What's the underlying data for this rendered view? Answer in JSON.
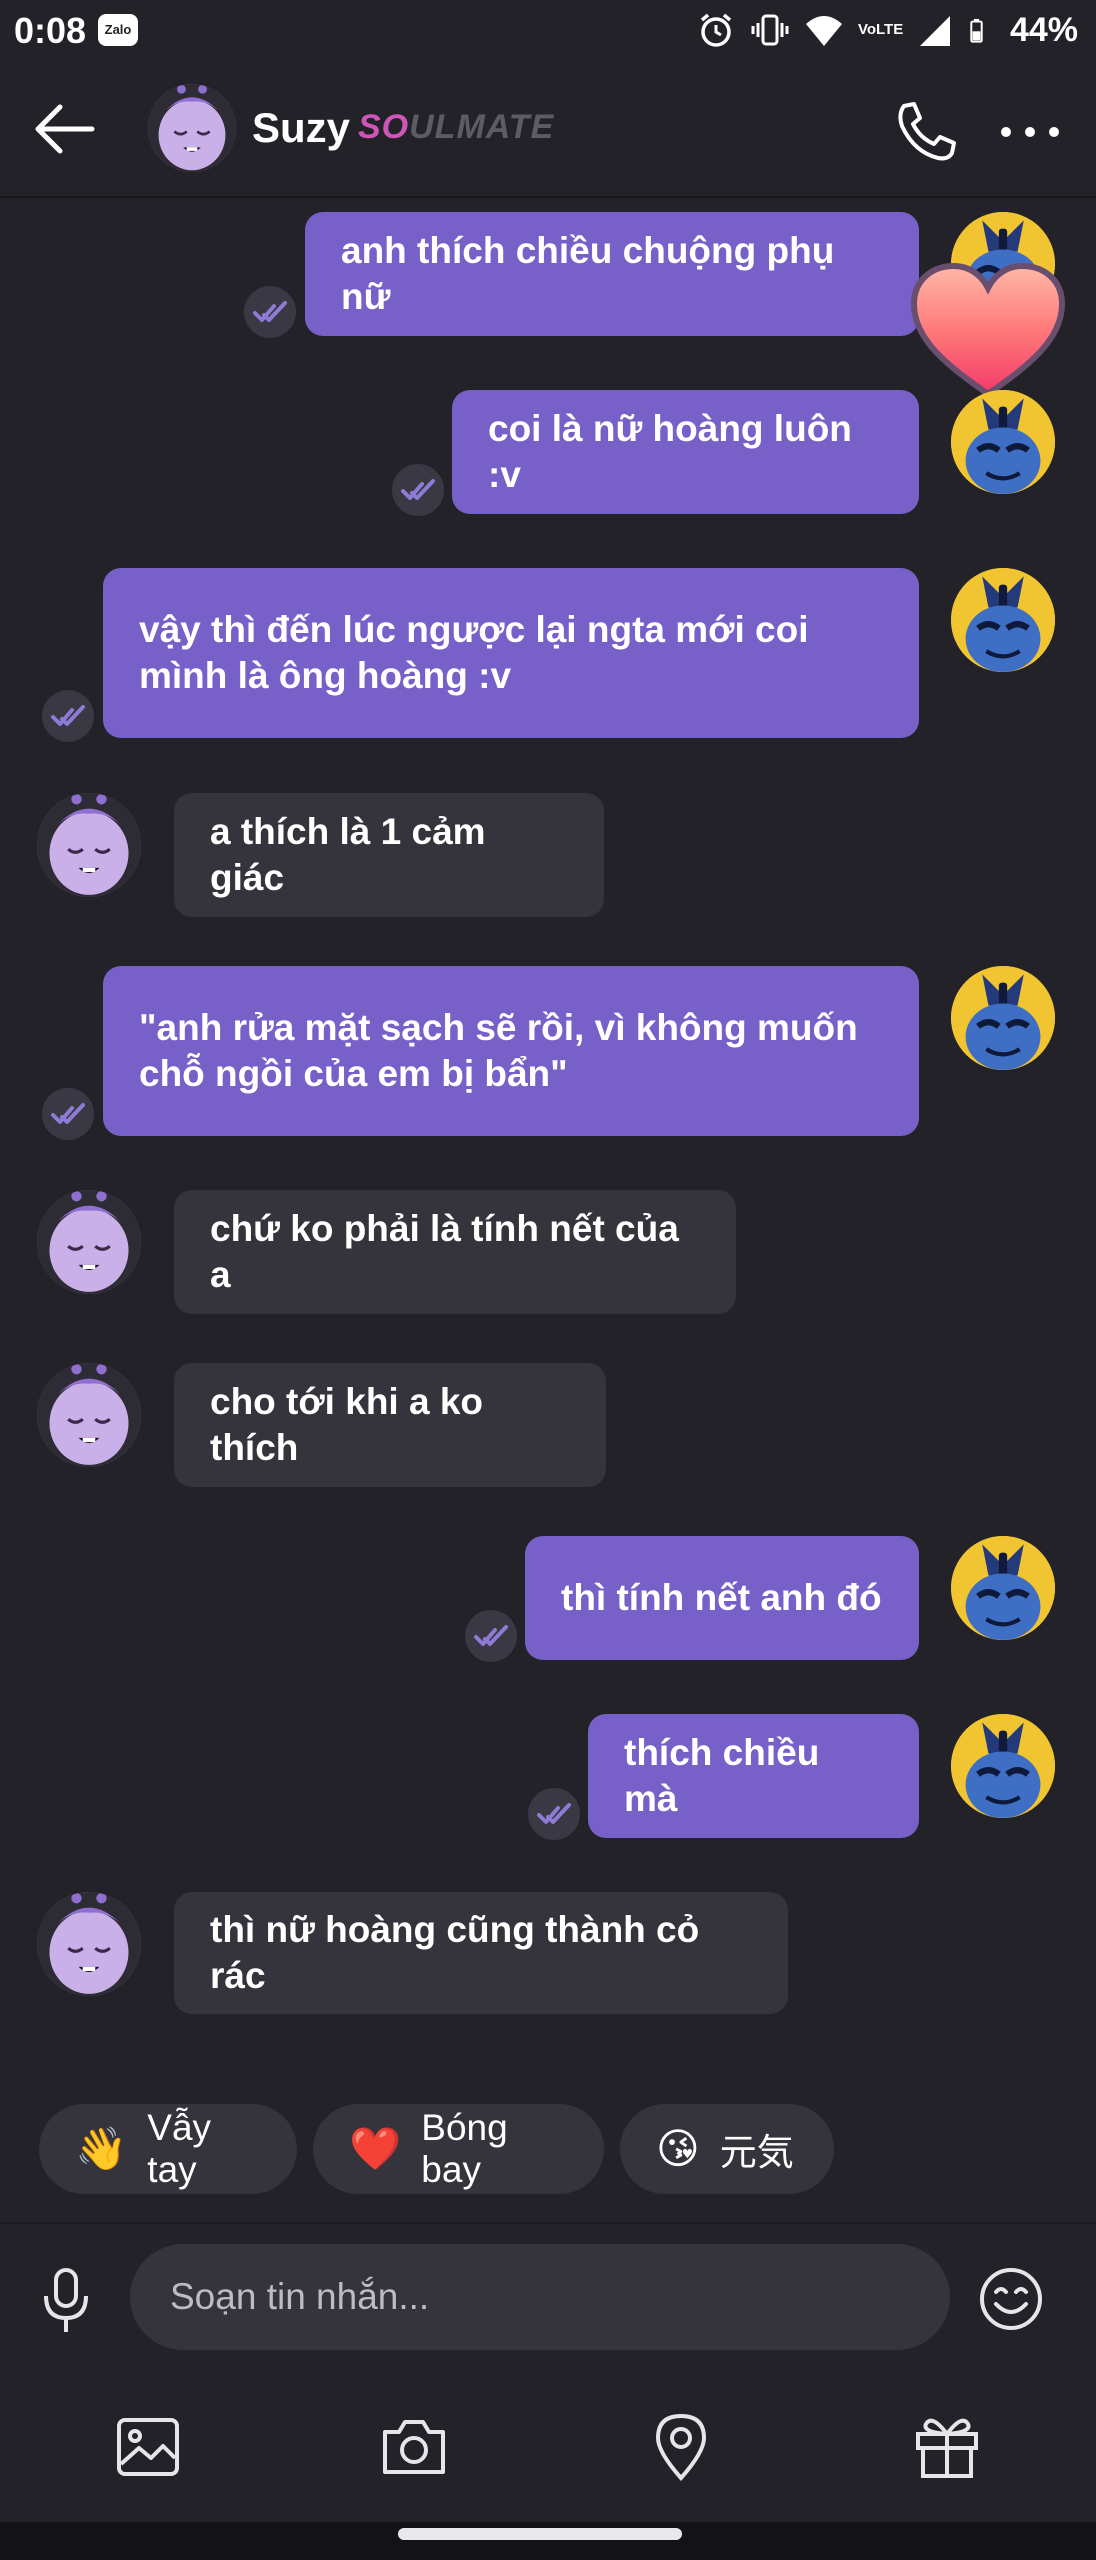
{
  "status_bar": {
    "time": "0:08",
    "notification_app": "Zalo",
    "network_label": "VoLTE",
    "battery": "44%",
    "icons": [
      "alarm-icon",
      "vibrate-icon",
      "wifi-icon",
      "volte-icon",
      "signal-icon",
      "battery-icon"
    ]
  },
  "header": {
    "contact_name": "Suzy",
    "badge_part1": "SO",
    "badge_part2": "ULMATE",
    "icons": [
      "back-arrow-icon",
      "phone-icon",
      "more-dots-icon"
    ]
  },
  "messages": [
    {
      "from": "me",
      "text": "anh thích chiều chuộng phụ nữ",
      "status": "read"
    },
    {
      "from": "me",
      "text": "coi là nữ hoàng luôn :v",
      "status": "read"
    },
    {
      "from": "me",
      "line1": "vậy thì đến lúc ngược lại ngta mới coi",
      "line2": "mình là ông hoàng :v",
      "status": "read"
    },
    {
      "from": "them",
      "text": "a thích là 1 cảm giác"
    },
    {
      "from": "me",
      "line1": "\"anh rửa mặt sạch sẽ rồi, vì không muốn",
      "line2": "chỗ ngồi của em bị bẩn\"",
      "status": "read"
    },
    {
      "from": "them",
      "text": "chứ ko phải là tính nết của a"
    },
    {
      "from": "them",
      "text": "cho tới khi a ko thích"
    },
    {
      "from": "me",
      "text": "thì tính nết anh đó",
      "status": "read"
    },
    {
      "from": "me",
      "text": "thích chiều mà",
      "status": "read"
    },
    {
      "from": "them",
      "text": "thì nữ hoàng cũng thành cỏ rác"
    }
  ],
  "quick_replies": [
    {
      "emoji": "👋",
      "label": "Vẫy tay"
    },
    {
      "emoji": "❤️",
      "label": "Bóng bay"
    },
    {
      "emoji": "😘",
      "label": "元気"
    }
  ],
  "composer": {
    "placeholder": "Soạn tin nhắn...",
    "icons": [
      "microphone-icon",
      "emoji-face-icon"
    ]
  },
  "toolbar": {
    "icons": [
      "gallery-icon",
      "camera-icon",
      "location-pin-icon",
      "gift-icon"
    ]
  },
  "colors": {
    "background": "#232229",
    "my_bubble": "#7761c9",
    "their_bubble": "#35333b",
    "my_avatar": "#f1c531",
    "their_avatar": "#8f72c8",
    "badge_accent": "#cf56b8"
  }
}
